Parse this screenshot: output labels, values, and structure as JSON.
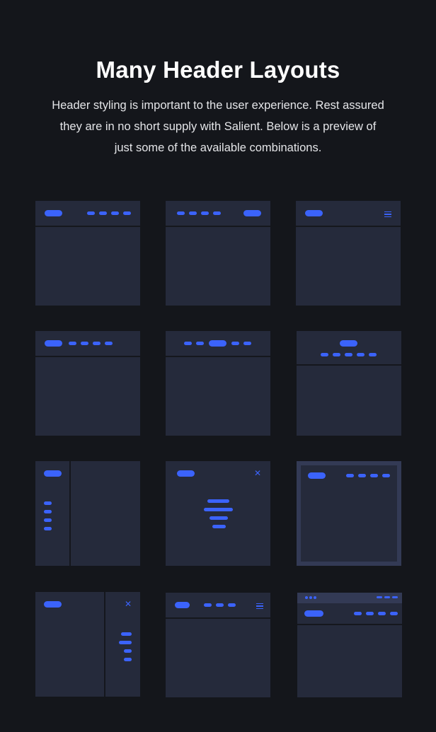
{
  "section": {
    "title": "Many Header Layouts",
    "description": "Header styling is important to the user experience. Rest assured they are in no short supply with Salient. Below is a preview of just some of the available combinations."
  },
  "colors": {
    "background": "#14161b",
    "card": "#252a3b",
    "accent": "#3b63fb",
    "frame": "#333a55"
  },
  "layouts": [
    {
      "name": "logo-left-menu-right",
      "nav_items": 4
    },
    {
      "name": "menu-left-logo-right",
      "nav_items": 4
    },
    {
      "name": "logo-left-hamburger-right",
      "icon": "hamburger-icon"
    },
    {
      "name": "logo-left-menu-left",
      "nav_items": 4
    },
    {
      "name": "logo-centered-in-menu",
      "nav_items": 4
    },
    {
      "name": "logo-centered-menu-below",
      "nav_items": 5
    },
    {
      "name": "left-vertical-sidebar",
      "nav_items": 4
    },
    {
      "name": "fullscreen-overlay-menu",
      "nav_items": 4,
      "icon": "close-icon"
    },
    {
      "name": "boxed-framed-layout",
      "nav_items": 4
    },
    {
      "name": "slide-out-right-panel",
      "nav_items": 4,
      "icon": "close-icon"
    },
    {
      "name": "menu-with-hamburger",
      "nav_items": 3,
      "icon": "hamburger-icon"
    },
    {
      "name": "secondary-top-bar",
      "nav_items": 4,
      "top_bar_left_dots": 3,
      "top_bar_right_items": 3
    }
  ]
}
